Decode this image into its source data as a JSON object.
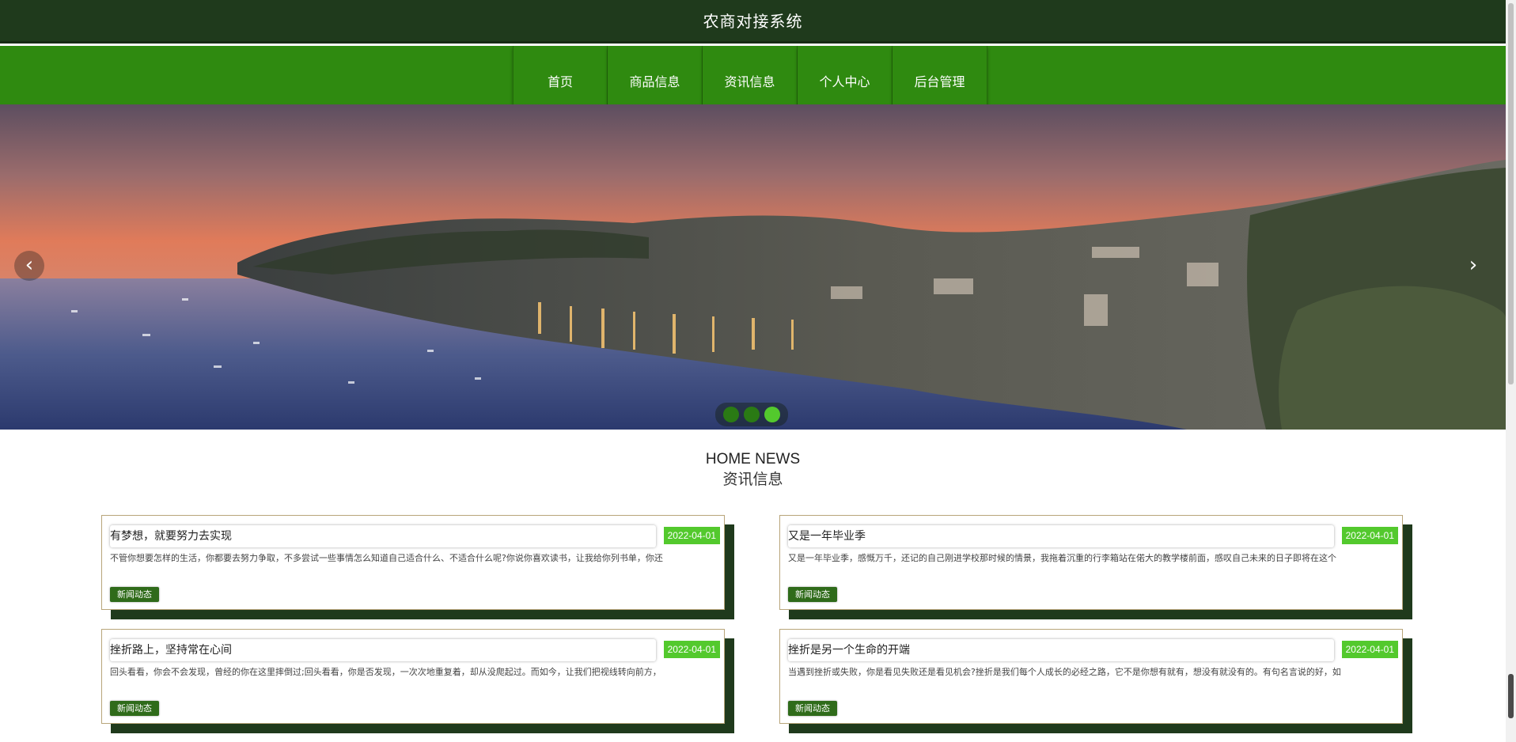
{
  "header": {
    "title": "农商对接系统"
  },
  "nav": {
    "items": [
      {
        "label": "首页"
      },
      {
        "label": "商品信息"
      },
      {
        "label": "资讯信息"
      },
      {
        "label": "个人中心"
      },
      {
        "label": "后台管理"
      }
    ]
  },
  "carousel": {
    "prev_icon": "chevron-left-icon",
    "next_icon": "chevron-right-icon",
    "prev_glyph": "‹",
    "next_glyph": "›",
    "slide_count": 3,
    "active_index": 2,
    "colors": {
      "active_dot": "#53c92d",
      "dot": "#2a7a14"
    }
  },
  "news_section": {
    "title_en": "HOME NEWS",
    "title_cn": "资讯信息",
    "items": [
      {
        "title": "有梦想，就要努力去实现",
        "date": "2022-04-01",
        "excerpt": "不管你想要怎样的生活，你都要去努力争取，不多尝试一些事情怎么知道自己适合什么、不适合什么呢?你说你喜欢读书，让我给你列书单，你还",
        "tag": "新闻动态"
      },
      {
        "title": "又是一年毕业季",
        "date": "2022-04-01",
        "excerpt": "又是一年毕业季，感慨万千，还记的自己刚进学校那时候的情景，我拖着沉重的行李箱站在偌大的教学楼前面，感叹自己未来的日子即将在这个",
        "tag": "新闻动态"
      },
      {
        "title": "挫折路上，坚持常在心间",
        "date": "2022-04-01",
        "excerpt": "回头看看，你会不会发现，曾经的你在这里摔倒过;回头看看，你是否发现，一次次地重复着，却从没爬起过。而如今，让我们把视线转向前方，",
        "tag": "新闻动态"
      },
      {
        "title": "挫折是另一个生命的开端",
        "date": "2022-04-01",
        "excerpt": "当遇到挫折或失败，你是看见失败还是看见机会?挫折是我们每个人成长的必经之路，它不是你想有就有，想没有就没有的。有句名言说的好，如",
        "tag": "新闻动态"
      }
    ]
  },
  "colors": {
    "header_bg": "#1f3a1c",
    "nav_bg": "#2f8a10",
    "date_badge": "#53c92d",
    "tag_bg": "#2f6b1a"
  }
}
